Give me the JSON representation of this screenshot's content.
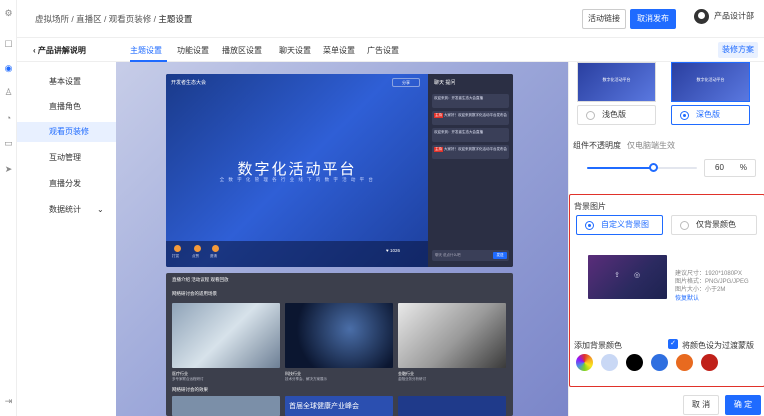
{
  "breadcrumb": {
    "part1": "虚拟场所",
    "sep1": "/",
    "part2": "直播区",
    "sep2": "/",
    "part3": "观看页装修",
    "sep3": "/",
    "current": "主题设置"
  },
  "header": {
    "activity_link": "活动链接",
    "cancel_publish": "取消发布",
    "user_name": "产品设计部"
  },
  "subnav": {
    "back_label": "产品讲解说明",
    "tabs": [
      "主题设置",
      "功能设置",
      "播放区设置",
      "聊天设置",
      "菜单设置",
      "广告设置"
    ],
    "active_tab": "主题设置",
    "design_plan": "装修方案"
  },
  "sidebar": {
    "items": [
      {
        "label": "基本设置"
      },
      {
        "label": "直播角色"
      },
      {
        "label": "观看页装修"
      },
      {
        "label": "互动管理"
      },
      {
        "label": "直播分发"
      },
      {
        "label": "数据统计"
      }
    ],
    "active": "观看页装修"
  },
  "preview": {
    "header_text": "开发者生态大会",
    "share_label": "分享",
    "title": "数字化活动平台",
    "subtitle": "全 数 字 化 管 理 各 行 业 线 下 的 数 字 活 动 平 台",
    "gift_labels": [
      "打赏",
      "点赞",
      "邀请"
    ],
    "like_count": "1026",
    "chat_tabs": "聊天    提问",
    "chat_messages": [
      "欢迎来到：开发者生态大会直播",
      "大家好！欢迎来到数字化活动平台发布会",
      "欢迎来到：开发者生态大会直播",
      "大家好！欢迎来到数字化活动平台发布会"
    ],
    "chat_tag": "主持",
    "chat_input": "聊天 说点什么吧",
    "send_label": "发送",
    "info_tabs": "直播介绍    活动议程    观看回放",
    "section_title": "网络研讨会的适用场景",
    "cards": [
      {
        "title": "医疗行业",
        "desc": "多专家联合远程研讨"
      },
      {
        "title": "科技行业",
        "desc": "技术分享会、解决方案展示"
      },
      {
        "title": "金融行业",
        "desc": "金融业务分析研讨"
      }
    ],
    "section_title2": "网络研讨会的效果",
    "banner_text": "首届全球健康产业峰会"
  },
  "right_panel": {
    "theme_options": [
      {
        "label": "浅色版",
        "thumb_title": "数字化活动平台",
        "selected": false
      },
      {
        "label": "深色版",
        "thumb_title": "数字化活动平台",
        "selected": true
      }
    ],
    "opacity_label": "组件不透明度",
    "opacity_hint": "仅电脑端生效",
    "opacity_value": "60",
    "opacity_unit": "%",
    "opacity_fraction": 0.6,
    "bg_image_label": "背景图片",
    "bg_options": [
      {
        "label": "自定义背景图",
        "selected": true
      },
      {
        "label": "仅背景颜色",
        "selected": false
      }
    ],
    "spec_size": "建议尺寸：1920*1080PX",
    "spec_format": "图片格式：PNG/JPG/JPEG",
    "spec_filesize": "图片大小：小于2M",
    "restore_default": "恢复默认",
    "add_color_label": "添加背景颜色",
    "mask_checkbox_label": "将颜色设为过渡蒙版",
    "mask_checked": true,
    "colors": [
      "rainbow",
      "#c9d8f5",
      "#000000",
      "#2f6fe0",
      "#e86a1f",
      "#c0211a"
    ],
    "cancel_label": "取 消",
    "confirm_label": "确 定"
  }
}
